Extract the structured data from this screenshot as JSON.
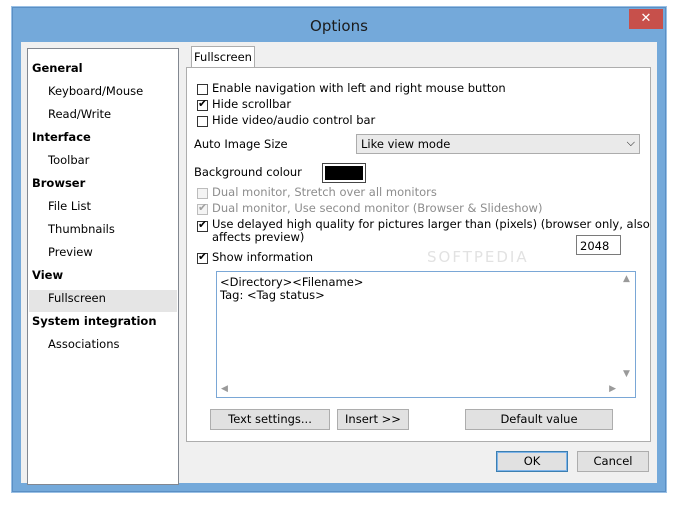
{
  "window": {
    "title": "Options",
    "close_label": "✕"
  },
  "tree": {
    "items": [
      {
        "label": "General",
        "level": 0
      },
      {
        "label": "Keyboard/Mouse",
        "level": 1
      },
      {
        "label": "Read/Write",
        "level": 1
      },
      {
        "label": "Interface",
        "level": 0
      },
      {
        "label": "Toolbar",
        "level": 1
      },
      {
        "label": "Browser",
        "level": 0
      },
      {
        "label": "File List",
        "level": 1
      },
      {
        "label": "Thumbnails",
        "level": 1
      },
      {
        "label": "Preview",
        "level": 1
      },
      {
        "label": "View",
        "level": 0
      },
      {
        "label": "Fullscreen",
        "level": 1,
        "selected": true
      },
      {
        "label": "System integration",
        "level": 0
      },
      {
        "label": "Associations",
        "level": 1
      }
    ]
  },
  "tab": {
    "label": "Fullscreen"
  },
  "options": {
    "enable_navigation": {
      "label": "Enable navigation with left and right mouse button",
      "checked": false
    },
    "hide_scrollbar": {
      "label": "Hide scrollbar",
      "checked": true
    },
    "hide_control_bar": {
      "label": "Hide video/audio control bar",
      "checked": false
    },
    "auto_image_size": {
      "label": "Auto Image Size",
      "value": "Like view mode"
    },
    "background_colour": {
      "label": "Background colour",
      "color": "#000000"
    },
    "dual_stretch": {
      "label": "Dual monitor, Stretch over all monitors",
      "checked": false,
      "disabled": true
    },
    "dual_second": {
      "label": "Dual monitor, Use second monitor (Browser & Slideshow)",
      "checked": true,
      "disabled": true
    },
    "delayed_quality": {
      "label_line1": "Use delayed high quality for pictures larger than (pixels) (browser only, also",
      "label_line2": "affects preview)",
      "checked": true,
      "value": "2048"
    },
    "show_information": {
      "label": "Show information",
      "checked": true
    }
  },
  "info_text": {
    "line1": "<Directory><Filename>",
    "line2": "Tag: <Tag status>"
  },
  "buttons": {
    "text_settings": "Text settings...",
    "insert": "Insert >>",
    "default_value": "Default value",
    "ok": "OK",
    "cancel": "Cancel"
  },
  "watermark": "SOFTPEDIA",
  "colors": {
    "title_bar": "#74a9da",
    "close_button": "#c7504b",
    "selected_row": "#e5e5e5"
  }
}
